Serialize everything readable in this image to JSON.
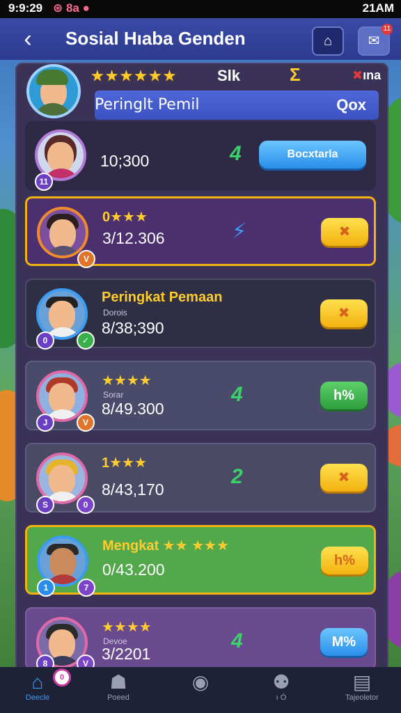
{
  "status_bar": {
    "time": "9:9:29",
    "icons_text": "⊛ 8a ●",
    "right_text": "21AM"
  },
  "header": {
    "title": "Sosial Hıaba Genden",
    "back_icon": "‹",
    "camera_icon": "⌂",
    "message_icon": "✉",
    "notification_count": "11"
  },
  "profile": {
    "stars": "★★★★★★",
    "stat_1": "Slk",
    "stat_2": "Σ",
    "stat_3_mark": "✖",
    "stat_3": "ına",
    "subbar_left": "Peringlt Pemil",
    "subbar_right": "Qox"
  },
  "rows": [
    {
      "title": "",
      "subtitle": "",
      "score": "10;300",
      "rank": "4",
      "rank_color": "#3ad06a",
      "action": "Bocxtarla",
      "action_style": "blue",
      "badge_left": "11",
      "badge_right": ""
    },
    {
      "title": "0★★★",
      "subtitle": "",
      "score": "3/12.306",
      "rank": "⚡",
      "rank_color": "#3c9cf0",
      "action": "✖",
      "action_style": "yellow",
      "badge_left": "",
      "badge_right": "V"
    },
    {
      "title": "Peringkat Pemaan",
      "subtitle": "Dorois",
      "score": "8/38;390",
      "rank": "",
      "rank_color": "#3ad06a",
      "action": "✖",
      "action_style": "yellow",
      "badge_left": "0",
      "badge_right": "✓"
    },
    {
      "title": "★★★★",
      "subtitle": "Sorar",
      "score": "8/49.300",
      "rank": "4",
      "rank_color": "#3ad06a",
      "action": "h%",
      "action_style": "green",
      "badge_left": "J",
      "badge_right": "V"
    },
    {
      "title": "1★★★",
      "subtitle": "",
      "score": "8/43,170",
      "rank": "2",
      "rank_color": "#3ad06a",
      "action": "✖",
      "action_style": "yellow",
      "badge_left": "S",
      "badge_right": "0"
    },
    {
      "title": "Mengkat ★★ ★★★",
      "subtitle": "",
      "score": "0/43.200",
      "rank": "",
      "rank_color": "#3ad06a",
      "action": "h%",
      "action_style": "yellow",
      "badge_left": "1",
      "badge_right": "7"
    },
    {
      "title": "★★★★",
      "subtitle": "Devoe",
      "score": "3/2201",
      "rank": "4",
      "rank_color": "#3ad06a",
      "action": "M%",
      "action_style": "blue",
      "badge_left": "8",
      "badge_right": "V"
    }
  ],
  "nav": [
    {
      "label": "Deecle",
      "icon": "⌂",
      "active": true
    },
    {
      "label": "Poeed",
      "icon": "☗",
      "active": false
    },
    {
      "label": "",
      "icon": "◉",
      "active": false
    },
    {
      "label": "ı Ó",
      "icon": "⚉",
      "active": false
    },
    {
      "label": "Tajeoletor",
      "icon": "▤",
      "active": false
    }
  ],
  "nav_badge": "0"
}
